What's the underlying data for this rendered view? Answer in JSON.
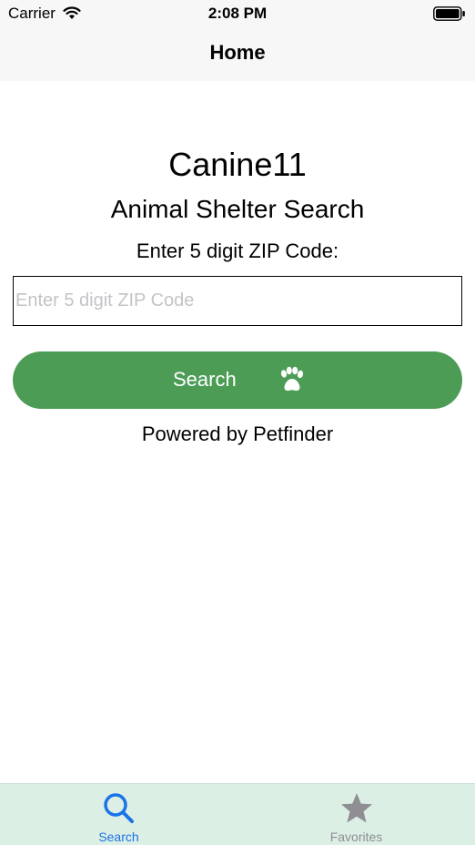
{
  "status_bar": {
    "carrier": "Carrier",
    "time": "2:08 PM"
  },
  "nav": {
    "title": "Home"
  },
  "main": {
    "app_title": "Canine11",
    "subtitle": "Animal Shelter Search",
    "zip_label": "Enter 5 digit ZIP Code:",
    "zip_input": {
      "value": "",
      "placeholder": "Enter 5 digit ZIP Code"
    },
    "search_button": {
      "label": "Search",
      "icon": "paw-icon",
      "color": "#4c9c56"
    },
    "powered_by": "Powered by Petfinder"
  },
  "tab_bar": {
    "background": "#dcefe5",
    "tabs": [
      {
        "label": "Search",
        "icon": "magnifier-icon",
        "selected": true,
        "color": "#1a73e8"
      },
      {
        "label": "Favorites",
        "icon": "star-icon",
        "selected": false,
        "color": "#8e8e93"
      }
    ]
  }
}
